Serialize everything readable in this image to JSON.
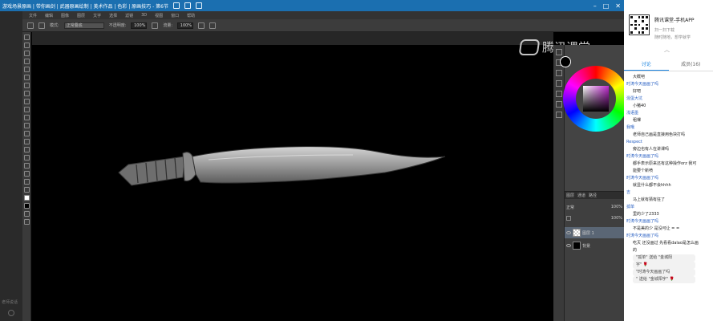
{
  "window": {
    "title": "游戏场景原画 | 带你画剑 | 武器原画绘制 | 美术作品 | 色彩 | 原画技巧 - 第6节"
  },
  "menu": [
    "文件",
    "编辑",
    "图像",
    "图层",
    "文字",
    "选择",
    "滤镜",
    "3D",
    "视图",
    "窗口",
    "帮助"
  ],
  "options": {
    "mode_label": "模式:",
    "mode_value": "正常叠底",
    "opacity_label": "不透明度:",
    "opacity_value": "100%",
    "flow_label": "流量:",
    "flow_value": "100%"
  },
  "canvas": {
    "watermark": "腾讯课堂"
  },
  "layers": {
    "tabs": [
      "图层",
      "通道",
      "路径"
    ],
    "blend": "正常",
    "opacity": "100%",
    "fill": "100%",
    "items": [
      {
        "name": "图层 1"
      },
      {
        "name": "背景"
      }
    ]
  },
  "left_strip": {
    "caption": "老师说话"
  },
  "sidebar": {
    "app_title": "腾讯课堂-手机APP",
    "app_sub1": "扫一扫下载",
    "app_sub2": "随时随地，想学就学",
    "tabs": [
      "讨论",
      "成员(16)"
    ],
    "chat": [
      {
        "type": "m",
        "text": "大概吧"
      },
      {
        "type": "u",
        "text": "时涛今天画画了吗"
      },
      {
        "type": "m",
        "text": "好吧"
      },
      {
        "type": "u",
        "text": "混蛋大坑"
      },
      {
        "type": "m",
        "text": "小猪40"
      },
      {
        "type": "u",
        "text": "浅语墨"
      },
      {
        "type": "m",
        "text": "租裸"
      },
      {
        "type": "u",
        "text": "我哦"
      },
      {
        "type": "m",
        "text": "老师自己画是直接用色块打吗"
      },
      {
        "type": "u",
        "text": "Respect"
      },
      {
        "type": "m",
        "text": "旁边也有人在讲课吗"
      },
      {
        "type": "u",
        "text": "时涛今天画画了吗"
      },
      {
        "type": "m",
        "text": "都手表示原来还有这种操作orz 我可"
      },
      {
        "type": "m",
        "text": "能要个新喷"
      },
      {
        "type": "u",
        "text": "时涛今天画画了吗"
      },
      {
        "type": "m",
        "text": "就显什么都不会hhhh"
      },
      {
        "type": "u",
        "text": "吉"
      },
      {
        "type": "m",
        "text": "马上就有猜有狂了"
      },
      {
        "type": "u",
        "text": "孤单"
      },
      {
        "type": "m",
        "text": "里的少了2333"
      },
      {
        "type": "u",
        "text": "时涛今天画画了吗"
      },
      {
        "type": "m",
        "text": "不是美的少 是没可让 = ="
      },
      {
        "type": "u",
        "text": "时涛今天画画了吗"
      },
      {
        "type": "m",
        "text": "吃灭 还没画过 先看看dalao是怎么画"
      },
      {
        "type": "m",
        "text": "的"
      },
      {
        "type": "s",
        "text": "\"孤单\" 送给 \"金城阳"
      },
      {
        "type": "s",
        "text": "宇\" 🌹"
      },
      {
        "type": "s",
        "text": "\"时涛今天画画了吗"
      },
      {
        "type": "s",
        "text": "\" 送给 \"金城阳宇\" 🌹"
      }
    ]
  },
  "colors": {
    "titlebar": "#1b6fb0",
    "accent": "#1b84e0",
    "username": "#2b62c4"
  }
}
